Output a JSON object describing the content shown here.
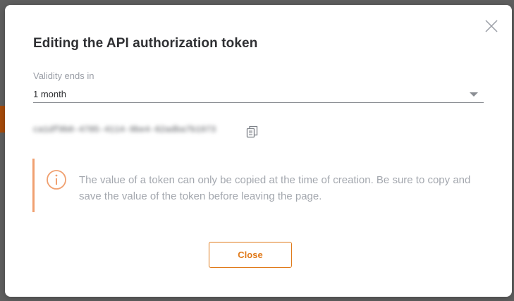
{
  "dialog": {
    "title": "Editing the API authorization token",
    "validity": {
      "label": "Validity ends in",
      "selected": "1 month"
    },
    "token": {
      "value": "ca1df9b0-4785-4114-9be4-62adba7b1973"
    },
    "notice": {
      "text": "The value of a token can only be copied at the time of creation. Be sure to copy and save the value of the token before leaving the page."
    },
    "buttons": {
      "close_label": "Close"
    }
  },
  "icons": {
    "dismiss": "close-icon",
    "copy": "copy-icon",
    "notice": "info-icon",
    "dropdown": "chevron-down-icon"
  },
  "colors": {
    "accent": "#e07a1a",
    "notice_border": "#f0a070",
    "title": "#2f3033",
    "muted_text": "#a3a7ae"
  }
}
